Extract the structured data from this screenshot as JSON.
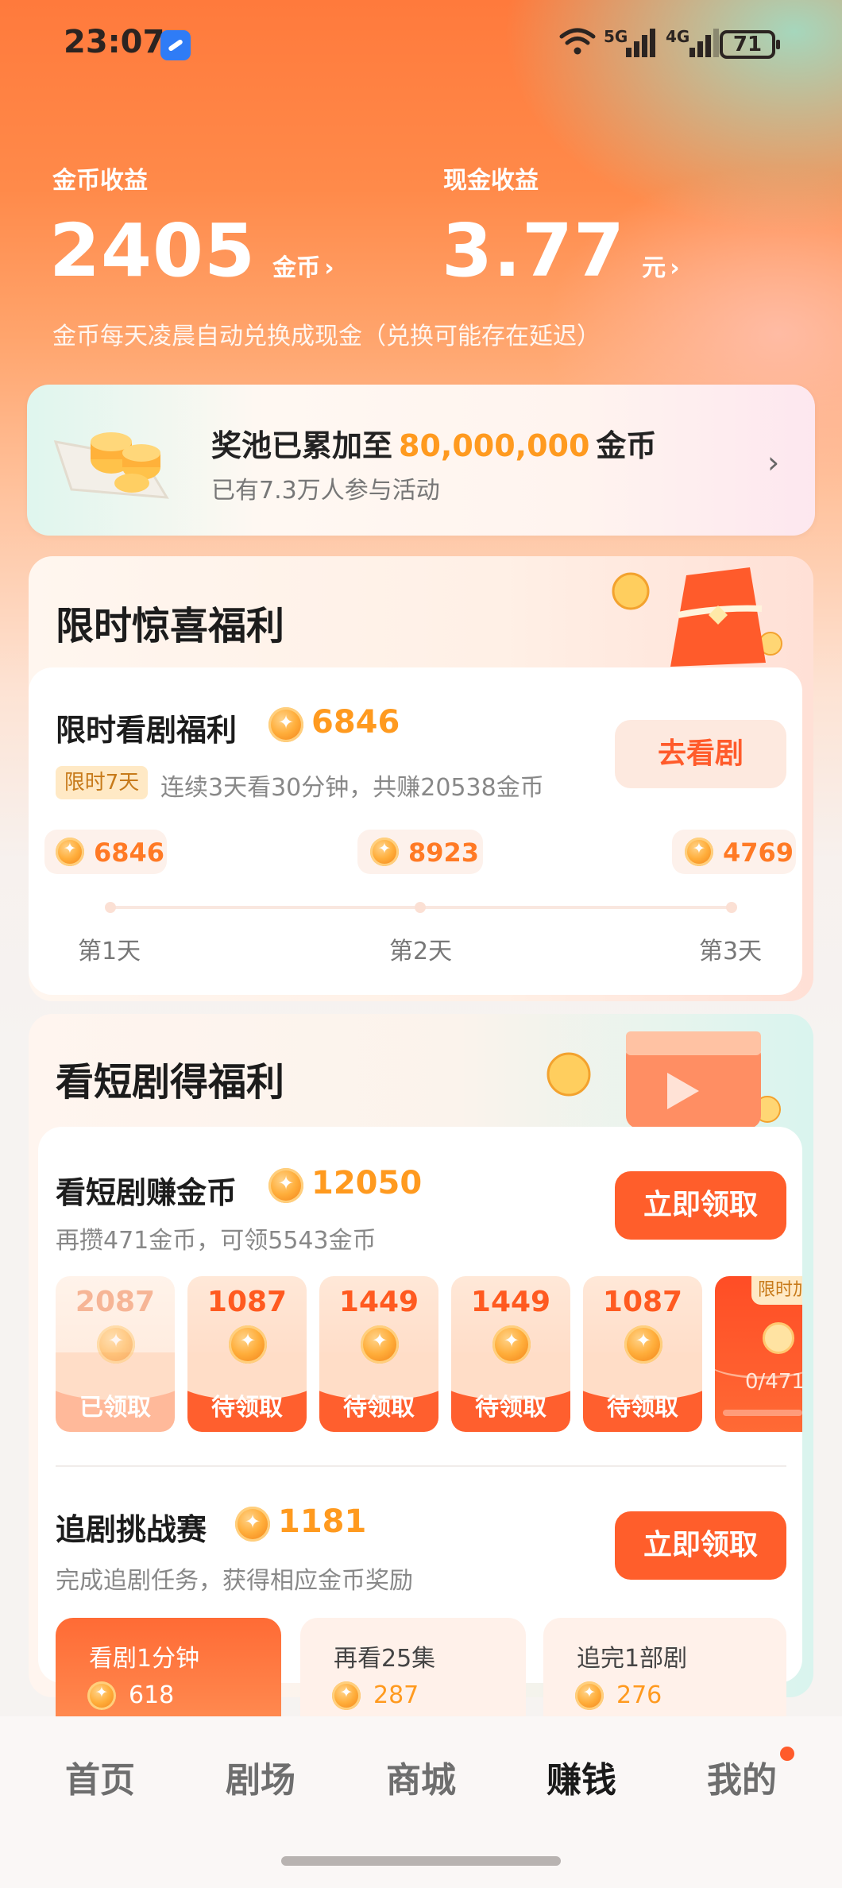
{
  "status_bar": {
    "time": "23:07",
    "battery": "71",
    "net1": "5G",
    "net2": "4G"
  },
  "earnings": {
    "coins_label": "金币收益",
    "coins_value": "2405",
    "coins_unit": "金币",
    "cash_label": "现金收益",
    "cash_value": "3.77",
    "cash_unit": "元",
    "note": "金币每天凌晨自动兑换成现金（兑换可能存在延迟）"
  },
  "pool": {
    "title_prefix": "奖池已累加至",
    "amount": "80,000,000",
    "title_suffix": "金币",
    "sub": "已有7.3万人参与活动"
  },
  "limited": {
    "section_title": "限时惊喜福利",
    "task_title": "限时看剧福利",
    "task_coins": "6846",
    "tag": "限时7天",
    "desc": "连续3天看30分钟，共赚20538金币",
    "button": "去看剧",
    "days": [
      {
        "coins": "6846",
        "label": "第1天"
      },
      {
        "coins": "8923",
        "label": "第2天"
      },
      {
        "coins": "4769",
        "label": "第3天"
      }
    ]
  },
  "short_drama": {
    "section_title": "看短剧得福利",
    "task_title": "看短剧赚金币",
    "task_coins": "12050",
    "desc": "再攒471金币，可领5543金币",
    "button": "立即领取",
    "tiles": [
      {
        "value": "2087",
        "status": "已领取"
      },
      {
        "value": "1087",
        "status": "待领取"
      },
      {
        "value": "1449",
        "status": "待领取"
      },
      {
        "value": "1449",
        "status": "待领取"
      },
      {
        "value": "1087",
        "status": "待领取"
      }
    ],
    "extra_tile": {
      "tag": "限时加",
      "progress": "0/471"
    }
  },
  "challenge": {
    "title": "追剧挑战赛",
    "coins": "1181",
    "desc": "完成追剧任务，获得相应金币奖励",
    "button": "立即领取",
    "tasks": [
      {
        "label": "看剧1分钟",
        "coins": "618"
      },
      {
        "label": "再看25集",
        "coins": "287"
      },
      {
        "label": "追完1部剧",
        "coins": "276"
      }
    ]
  },
  "nav": {
    "items": [
      "首页",
      "剧场",
      "商城",
      "赚钱",
      "我的"
    ],
    "active": "赚钱"
  },
  "colors": {
    "accent": "#ff5e2b",
    "coin_text": "#ff9a1f"
  }
}
